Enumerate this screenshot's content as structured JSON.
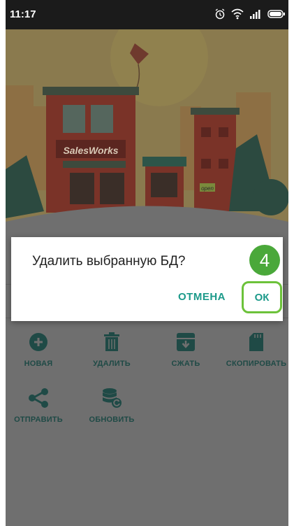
{
  "status_bar": {
    "time": "11:17",
    "icons": [
      "alarm-icon",
      "wifi-icon",
      "signal-icon",
      "battery-icon"
    ]
  },
  "banner": {
    "sign_text": "SalesWorks",
    "shop_sign": "open"
  },
  "dialog": {
    "message": "Удалить выбранную БД?",
    "cancel_label": "ОТМЕНА",
    "ok_label": "ОК"
  },
  "step_badge": "4",
  "actions": [
    {
      "label": "НОВАЯ",
      "icon": "add-circle-icon"
    },
    {
      "label": "УДАЛИТЬ",
      "icon": "trash-icon"
    },
    {
      "label": "СЖАТЬ",
      "icon": "archive-icon"
    },
    {
      "label": "СКОПИРОВАТЬ",
      "icon": "sd-card-icon"
    },
    {
      "label": "ОТПРАВИТЬ",
      "icon": "share-icon"
    },
    {
      "label": "ОБНОВИТЬ",
      "icon": "database-refresh-icon"
    }
  ],
  "colors": {
    "accent": "#1c9a8a",
    "icon_dark": "#1f4a46",
    "step_green": "#4aa83a",
    "dim": "#6f6f6f"
  }
}
